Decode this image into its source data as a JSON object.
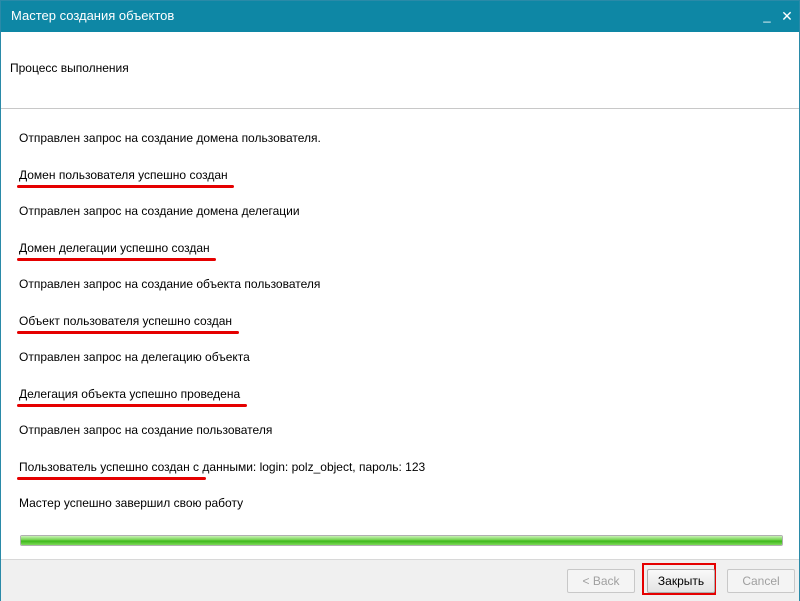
{
  "window": {
    "title": "Мастер создания объектов",
    "minimize_glyph": "_",
    "close_glyph": "✕"
  },
  "header": {
    "text": "Процесс выполнения"
  },
  "messages": [
    {
      "text": "Отправлен запрос на создание домена пользователя.",
      "highlighted": false
    },
    {
      "text": "Домен пользователя успешно создан",
      "highlighted": true
    },
    {
      "text": "Отправлен запрос на создание домена делегации",
      "highlighted": false
    },
    {
      "text": "Домен делегации успешно создан",
      "highlighted": true
    },
    {
      "text": "Отправлен запрос на создание объекта пользователя",
      "highlighted": false
    },
    {
      "text": "Объект пользователя успешно создан",
      "highlighted": true
    },
    {
      "text": "Отправлен запрос на делегацию объекта",
      "highlighted": false
    },
    {
      "text": "Делегация объекта успешно проведена",
      "highlighted": true
    },
    {
      "text": "Отправлен запрос на создание пользователя",
      "highlighted": false
    },
    {
      "text": "Пользователь успешно создан с данными: login: polz_object, пароль: 123",
      "highlighted": true
    },
    {
      "text": "Мастер успешно завершил свою работу",
      "highlighted": false
    }
  ],
  "progress": {
    "fraction": 1.0
  },
  "buttons": {
    "back_label": "< Back",
    "close_label": "Закрыть",
    "cancel_label": "Cancel"
  },
  "colors": {
    "titlebar": "#0e87a5",
    "highlight": "#e50000",
    "progress": "#3cb71a"
  }
}
